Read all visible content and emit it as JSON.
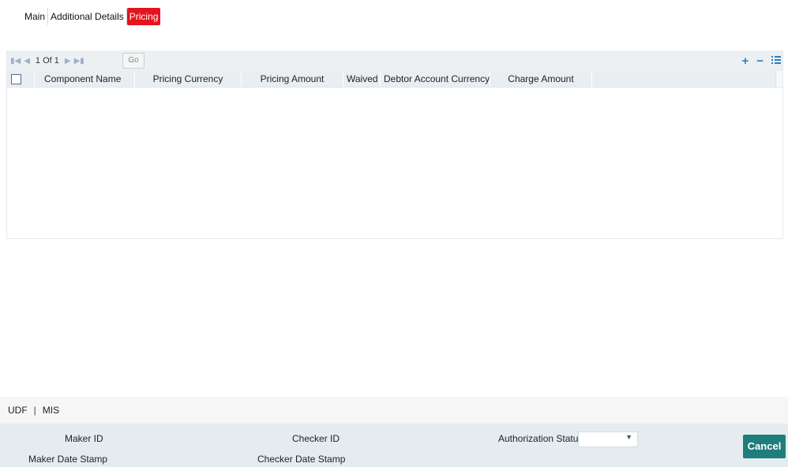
{
  "tabs": [
    "Main",
    "Additional Details",
    "Pricing"
  ],
  "grid": {
    "pager_text": "1 Of 1",
    "go_label": "Go",
    "add_label": "+",
    "remove_label": "−",
    "columns": [
      "Component Name",
      "Pricing Currency",
      "Pricing Amount",
      "Waived",
      "Debtor Account Currency",
      "Charge Amount"
    ]
  },
  "footer": {
    "udf_label": "UDF",
    "separator": "|",
    "mis_label": "MIS"
  },
  "audit": {
    "maker_id": "Maker ID",
    "maker_date": "Maker Date Stamp",
    "checker_id": "Checker ID",
    "checker_date": "Checker Date Stamp",
    "auth_status": "Authorization Status",
    "auth_status_value": "",
    "cancel_label": "Cancel"
  },
  "colors": {
    "active_tab": "#e5131c",
    "cancel_button": "#1e7e7b",
    "audit_bg": "#e4ecf0",
    "toolbar_icons": "#2a7fb8"
  }
}
